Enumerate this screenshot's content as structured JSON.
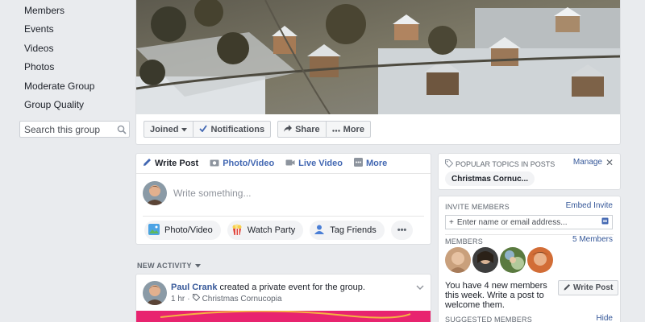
{
  "sidebar": {
    "items": [
      {
        "label": "Members"
      },
      {
        "label": "Events"
      },
      {
        "label": "Videos"
      },
      {
        "label": "Photos"
      },
      {
        "label": "Moderate Group"
      },
      {
        "label": "Group Quality"
      }
    ],
    "search_placeholder": "Search this group",
    "search_icon": "search-icon"
  },
  "actions": {
    "joined_label": "Joined",
    "notifications_label": "Notifications",
    "share_label": "Share",
    "more_label": "More"
  },
  "composer": {
    "tabs": [
      {
        "label": "Write Post",
        "icon": "pencil-icon"
      },
      {
        "label": "Photo/Video",
        "icon": "camera-icon"
      },
      {
        "label": "Live Video",
        "icon": "live-video-icon"
      },
      {
        "label": "More",
        "icon": "grid-icon"
      }
    ],
    "placeholder": "Write something...",
    "pills": [
      {
        "label": "Photo/Video",
        "icon": "photo-icon"
      },
      {
        "label": "Watch Party",
        "icon": "popcorn-icon"
      },
      {
        "label": "Tag Friends",
        "icon": "tag-friends-icon"
      }
    ],
    "more_dots": "•••"
  },
  "activity": {
    "heading": "NEW ACTIVITY",
    "post": {
      "author": "Paul Crank",
      "action": " created a private event for the group.",
      "time": "1 hr",
      "separator": "·",
      "event": "Christmas Cornucopia"
    }
  },
  "topics": {
    "heading": "POPULAR TOPICS IN POSTS",
    "manage": "Manage",
    "close": "✕",
    "chip": "Christmas Cornuc..."
  },
  "members_card": {
    "invite_label": "INVITE MEMBERS",
    "embed_invite": "Embed Invite",
    "invite_placeholder": "Enter name or email address...",
    "members_label": "MEMBERS",
    "members_count": "5 Members",
    "new_members_text": "You have 4 new members this week. Write a post to welcome them.",
    "write_post": "Write Post",
    "suggested_label": "SUGGESTED MEMBERS",
    "hide": "Hide"
  },
  "colors": {
    "link": "#365899",
    "tab_blue": "#4267b2",
    "page_bg": "#e9ebee",
    "event_banner": "#e8246f"
  }
}
